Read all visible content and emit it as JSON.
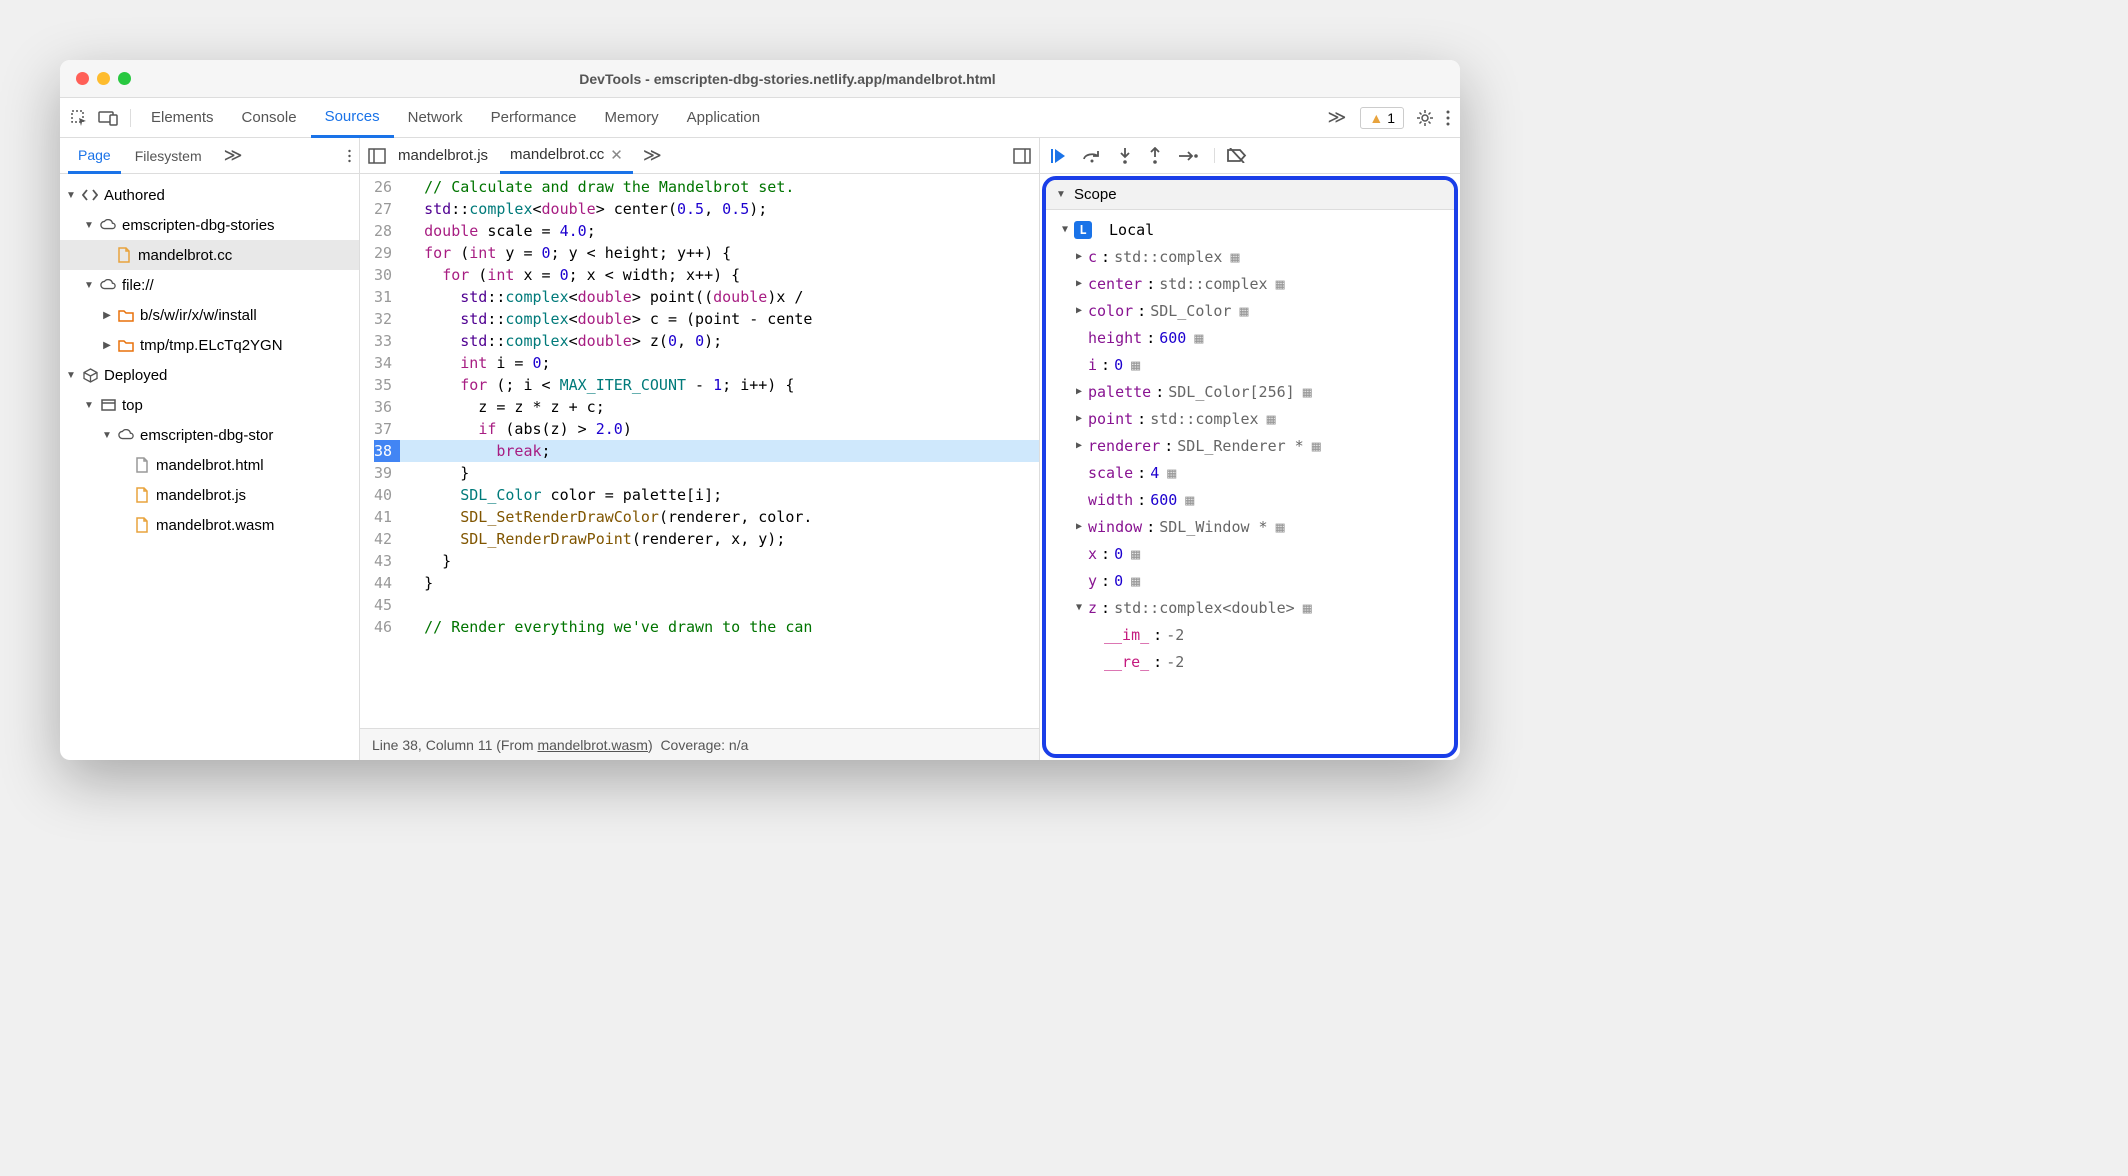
{
  "window": {
    "title": "DevTools - emscripten-dbg-stories.netlify.app/mandelbrot.html"
  },
  "topbar": {
    "tabs": [
      "Elements",
      "Console",
      "Sources",
      "Network",
      "Performance",
      "Memory",
      "Application"
    ],
    "active": "Sources",
    "warning_count": "1"
  },
  "navigator": {
    "tabs": [
      "Page",
      "Filesystem"
    ],
    "active": "Page",
    "tree": {
      "authored_label": "Authored",
      "domain1": "emscripten-dbg-stories",
      "file_mandelbrot_cc": "mandelbrot.cc",
      "file_scheme": "file://",
      "folder1": "b/s/w/ir/x/w/install",
      "folder2": "tmp/tmp.ELcTq2YGN",
      "deployed_label": "Deployed",
      "top": "top",
      "domain2": "emscripten-dbg-stor",
      "html": "mandelbrot.html",
      "js": "mandelbrot.js",
      "wasm": "mandelbrot.wasm"
    }
  },
  "editor": {
    "tabs": {
      "js": "mandelbrot.js",
      "cc": "mandelbrot.cc"
    },
    "lines": [
      {
        "n": 26,
        "indent": 1,
        "t": "comment",
        "text": "// Calculate and draw the Mandelbrot set."
      },
      {
        "n": 27,
        "indent": 1,
        "segs": [
          {
            "c": "c-ns",
            "t": "std"
          },
          {
            "t": "::"
          },
          {
            "c": "c-type",
            "t": "complex"
          },
          {
            "t": "<"
          },
          {
            "c": "c-kw",
            "t": "double"
          },
          {
            "t": "> center("
          },
          {
            "c": "c-num",
            "t": "0.5"
          },
          {
            "t": ", "
          },
          {
            "c": "c-num",
            "t": "0.5"
          },
          {
            "t": ");"
          }
        ]
      },
      {
        "n": 28,
        "indent": 1,
        "segs": [
          {
            "c": "c-kw",
            "t": "double"
          },
          {
            "t": " scale = "
          },
          {
            "c": "c-num",
            "t": "4.0"
          },
          {
            "t": ";"
          }
        ]
      },
      {
        "n": 29,
        "indent": 1,
        "segs": [
          {
            "c": "c-kw",
            "t": "for"
          },
          {
            "t": " ("
          },
          {
            "c": "c-kw",
            "t": "int"
          },
          {
            "t": " y = "
          },
          {
            "c": "c-num",
            "t": "0"
          },
          {
            "t": "; y < height; y++) {"
          }
        ]
      },
      {
        "n": 30,
        "indent": 2,
        "segs": [
          {
            "c": "c-kw",
            "t": "for"
          },
          {
            "t": " ("
          },
          {
            "c": "c-kw",
            "t": "int"
          },
          {
            "t": " x = "
          },
          {
            "c": "c-num",
            "t": "0"
          },
          {
            "t": "; x < width; x++) {"
          }
        ]
      },
      {
        "n": 31,
        "indent": 3,
        "segs": [
          {
            "c": "c-ns",
            "t": "std"
          },
          {
            "t": "::"
          },
          {
            "c": "c-type",
            "t": "complex"
          },
          {
            "t": "<"
          },
          {
            "c": "c-kw",
            "t": "double"
          },
          {
            "t": "> point(("
          },
          {
            "c": "c-kw",
            "t": "double"
          },
          {
            "t": ")x /"
          }
        ]
      },
      {
        "n": 32,
        "indent": 3,
        "segs": [
          {
            "c": "c-ns",
            "t": "std"
          },
          {
            "t": "::"
          },
          {
            "c": "c-type",
            "t": "complex"
          },
          {
            "t": "<"
          },
          {
            "c": "c-kw",
            "t": "double"
          },
          {
            "t": "> c = (point - cente"
          }
        ]
      },
      {
        "n": 33,
        "indent": 3,
        "segs": [
          {
            "c": "c-ns",
            "t": "std"
          },
          {
            "t": "::"
          },
          {
            "c": "c-type",
            "t": "complex"
          },
          {
            "t": "<"
          },
          {
            "c": "c-kw",
            "t": "double"
          },
          {
            "t": "> z("
          },
          {
            "c": "c-num",
            "t": "0"
          },
          {
            "t": ", "
          },
          {
            "c": "c-num",
            "t": "0"
          },
          {
            "t": ");"
          }
        ]
      },
      {
        "n": 34,
        "indent": 3,
        "segs": [
          {
            "c": "c-kw",
            "t": "int"
          },
          {
            "t": " i = "
          },
          {
            "c": "c-num",
            "t": "0"
          },
          {
            "t": ";"
          }
        ]
      },
      {
        "n": 35,
        "indent": 3,
        "segs": [
          {
            "c": "c-kw",
            "t": "for"
          },
          {
            "t": " (; i < "
          },
          {
            "c": "c-const",
            "t": "MAX_ITER_COUNT"
          },
          {
            "t": " - "
          },
          {
            "c": "c-num",
            "t": "1"
          },
          {
            "t": "; i++) {"
          }
        ]
      },
      {
        "n": 36,
        "indent": 4,
        "segs": [
          {
            "t": "z = z * z + c;"
          }
        ]
      },
      {
        "n": 37,
        "indent": 4,
        "segs": [
          {
            "c": "c-kw",
            "t": "if"
          },
          {
            "t": " (abs(z) > "
          },
          {
            "c": "c-num",
            "t": "2.0"
          },
          {
            "t": ")"
          }
        ]
      },
      {
        "n": 38,
        "indent": 5,
        "paused": true,
        "segs": [
          {
            "c": "c-kw",
            "t": "break"
          },
          {
            "t": ";"
          }
        ]
      },
      {
        "n": 39,
        "indent": 3,
        "segs": [
          {
            "t": "}"
          }
        ]
      },
      {
        "n": 40,
        "indent": 3,
        "segs": [
          {
            "c": "c-type",
            "t": "SDL_Color"
          },
          {
            "t": " color = palette[i];"
          }
        ]
      },
      {
        "n": 41,
        "indent": 3,
        "segs": [
          {
            "c": "c-fn",
            "t": "SDL_SetRenderDrawColor"
          },
          {
            "t": "(renderer, color."
          }
        ]
      },
      {
        "n": 42,
        "indent": 3,
        "segs": [
          {
            "c": "c-fn",
            "t": "SDL_RenderDrawPoint"
          },
          {
            "t": "(renderer, x, y);"
          }
        ]
      },
      {
        "n": 43,
        "indent": 2,
        "segs": [
          {
            "t": "}"
          }
        ]
      },
      {
        "n": 44,
        "indent": 1,
        "segs": [
          {
            "t": "}"
          }
        ]
      },
      {
        "n": 45,
        "indent": 0,
        "segs": [
          {
            "t": ""
          }
        ]
      },
      {
        "n": 46,
        "indent": 1,
        "t": "comment",
        "text": "// Render everything we've drawn to the can"
      }
    ],
    "status": {
      "loc": "Line 38, Column 11",
      "from_label": "(From ",
      "from_link": "mandelbrot.wasm",
      "from_close": ")",
      "coverage": "Coverage: n/a"
    }
  },
  "scope": {
    "header": "Scope",
    "local_label": "Local",
    "vars": [
      {
        "exp": true,
        "name": "c",
        "val": "std::complex<double>",
        "mem": true
      },
      {
        "exp": true,
        "name": "center",
        "val": "std::complex<double>",
        "mem": true
      },
      {
        "exp": true,
        "name": "color",
        "val": "SDL_Color",
        "mem": true
      },
      {
        "exp": false,
        "name": "height",
        "num": "600",
        "mem": true
      },
      {
        "exp": false,
        "name": "i",
        "num": "0",
        "mem": true
      },
      {
        "exp": true,
        "name": "palette",
        "val": "SDL_Color[256]",
        "mem": true
      },
      {
        "exp": true,
        "name": "point",
        "val": "std::complex<double>",
        "mem": true
      },
      {
        "exp": true,
        "name": "renderer",
        "val": "SDL_Renderer *",
        "mem": true
      },
      {
        "exp": false,
        "name": "scale",
        "num": "4",
        "mem": true
      },
      {
        "exp": false,
        "name": "width",
        "num": "600",
        "mem": true
      },
      {
        "exp": true,
        "name": "window",
        "val": "SDL_Window *",
        "mem": true
      },
      {
        "exp": false,
        "name": "x",
        "num": "0",
        "mem": true
      },
      {
        "exp": false,
        "name": "y",
        "num": "0",
        "mem": true
      }
    ],
    "z_name": "z",
    "z_val": "std::complex<double>",
    "z_im_name": "__im_",
    "z_im_val": "-2",
    "z_re_name": "__re_",
    "z_re_val": "-2"
  }
}
